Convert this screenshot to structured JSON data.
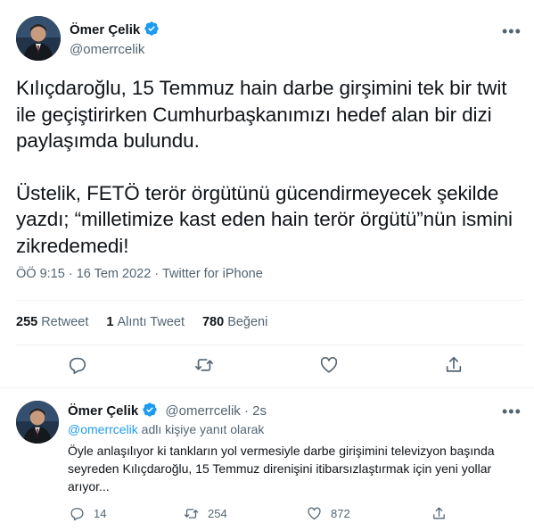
{
  "tweet": {
    "author_name": "Ömer Çelik",
    "author_handle": "@omerrcelik",
    "paragraph1": "Kılıçdaroğlu, 15 Temmuz hain darbe girşimini tek bir twit ile geçiştirirken Cumhurbaşkanımızı hedef alan bir dizi paylaşımda bulundu.",
    "paragraph2": "Üstelik, FETÖ terör örgütünü gücendirmeyecek şekilde yazdı; “milletimize kast eden hain terör örgütü”nün ismini zikredemedi!",
    "time": "ÖÖ 9:15",
    "separator": "·",
    "date": "16 Tem 2022",
    "source": "Twitter for iPhone",
    "stats": {
      "retweets_count": "255",
      "retweets_label": "Retweet",
      "quotes_count": "1",
      "quotes_label": "Alıntı Tweet",
      "likes_count": "780",
      "likes_label": "Beğeni"
    }
  },
  "reply": {
    "author_name": "Ömer Çelik",
    "author_handle": "@omerrcelik",
    "separator": "·",
    "age": "2s",
    "replying_to_handle": "@omerrcelik",
    "replying_to_suffix": "adlı kişiye yanıt olarak",
    "text": "Öyle anlaşılıyor ki tankların yol vermesiyle darbe girişimini televizyon başında seyreden Kılıçdaroğlu, 15 Temmuz direnişini itibarsızlaştırmak için yeni yollar arıyor...",
    "replies_count": "14",
    "retweets_count": "254",
    "likes_count": "872"
  },
  "icons": {
    "verified": "verified-badge-icon",
    "more": "more-icon",
    "reply": "reply-icon",
    "retweet": "retweet-icon",
    "like": "heart-icon",
    "share": "share-icon"
  },
  "colors": {
    "accent": "#1d9bf0",
    "text": "#0f1419",
    "secondary": "#536471",
    "divider": "#eff3f4"
  }
}
